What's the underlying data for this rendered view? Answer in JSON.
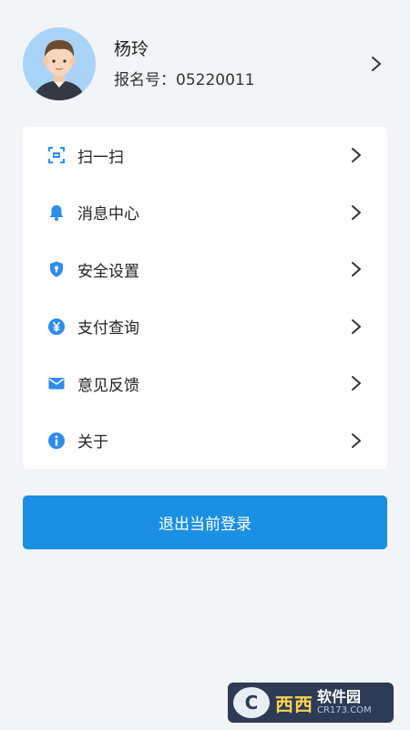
{
  "profile": {
    "name": "杨玲",
    "registration": "报名号：05220011"
  },
  "menu": {
    "items": [
      {
        "label": "扫一扫",
        "icon": "scan-icon"
      },
      {
        "label": "消息中心",
        "icon": "bell-icon"
      },
      {
        "label": "安全设置",
        "icon": "shield-icon"
      },
      {
        "label": "支付查询",
        "icon": "yuan-icon"
      },
      {
        "label": "意见反馈",
        "icon": "mail-icon"
      },
      {
        "label": "关于",
        "icon": "info-icon"
      }
    ]
  },
  "logout": {
    "label": "退出当前登录"
  },
  "watermark": {
    "title": "西西",
    "brand": "软件园",
    "url": "CR173.COM"
  },
  "colors": {
    "accent": "#1b8fe3",
    "icon_blue": "#2f8cec",
    "background": "#f3f4f8"
  }
}
